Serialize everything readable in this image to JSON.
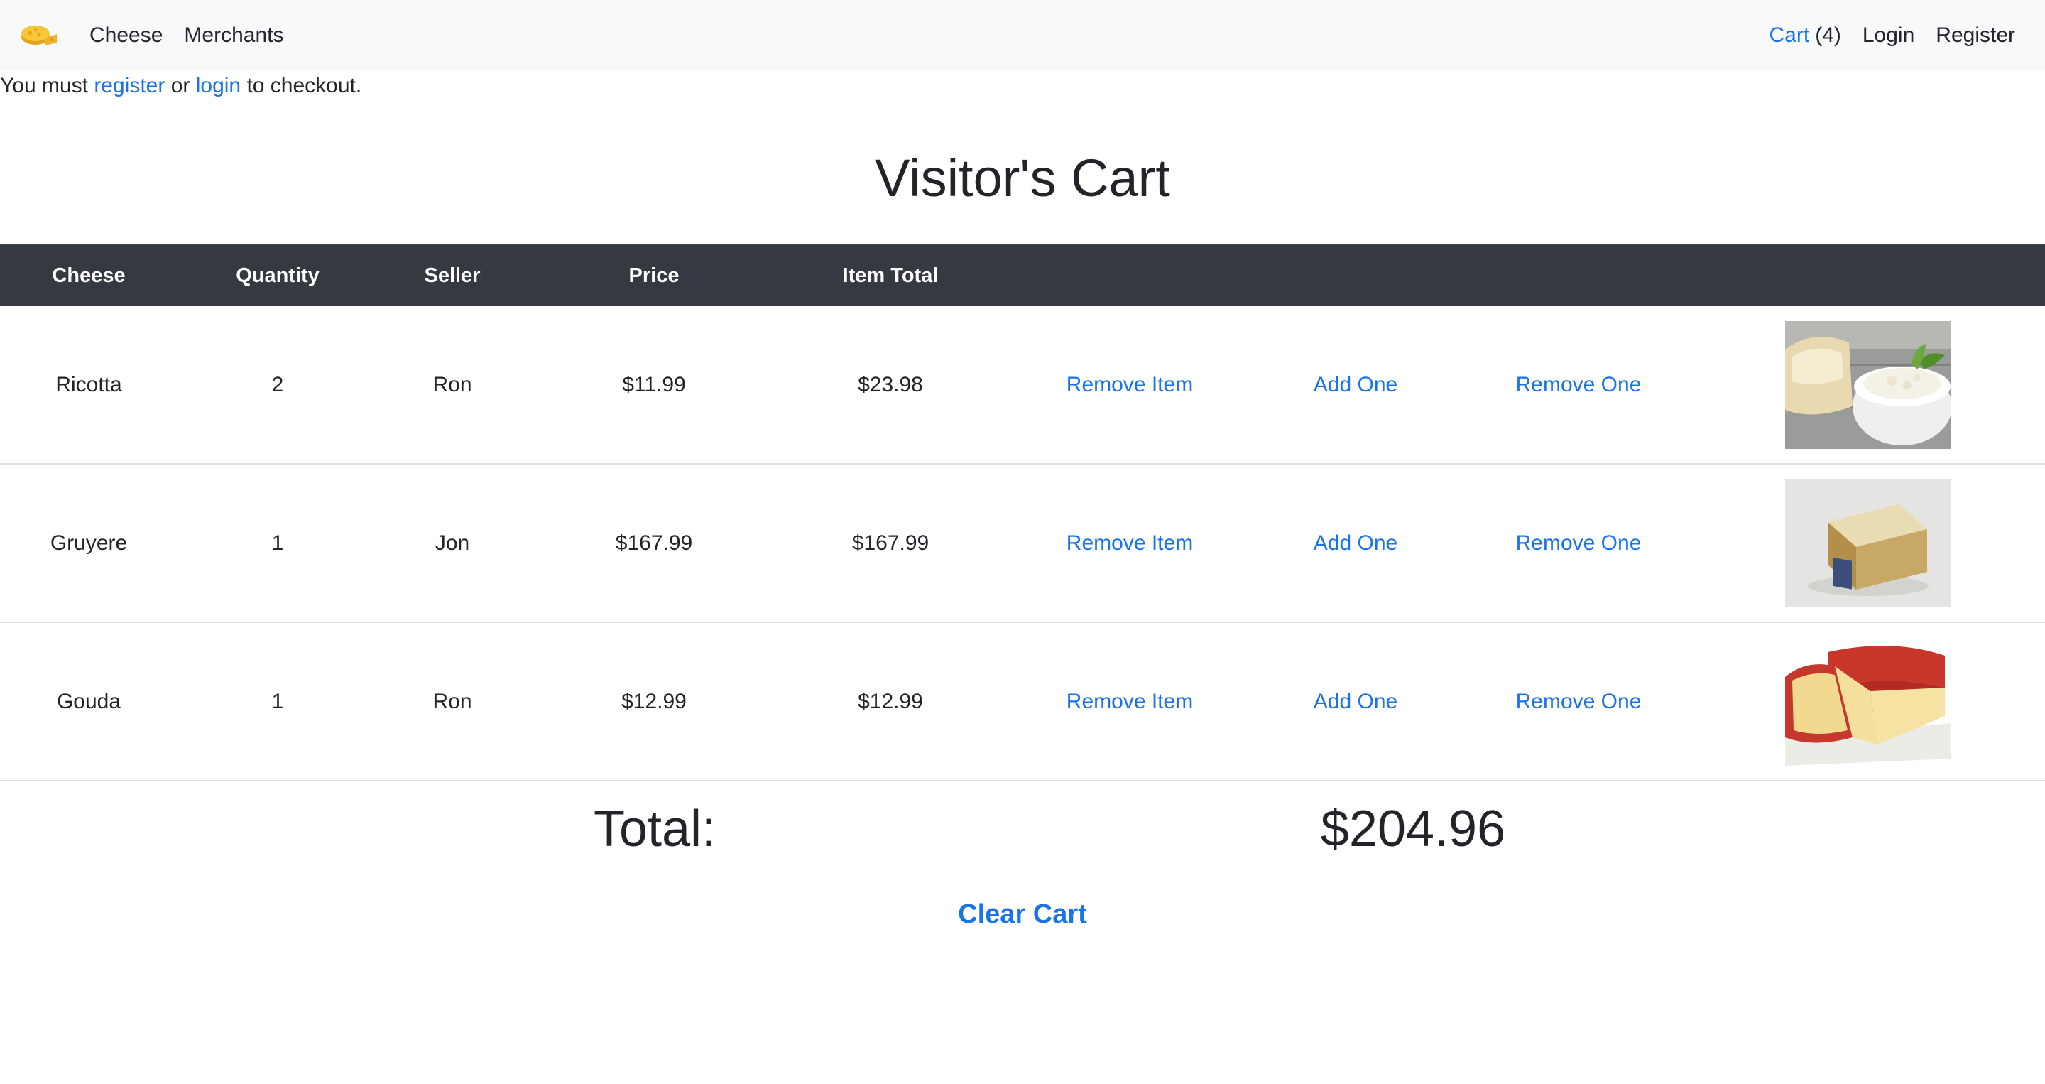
{
  "nav": {
    "brand_icon": "cheese-logo-icon",
    "left_links": [
      "Cheese",
      "Merchants"
    ],
    "cart_label": "Cart",
    "cart_count": "(4)",
    "login": "Login",
    "register": "Register"
  },
  "notice": {
    "prefix": "You must ",
    "register_link": "register",
    "middle": " or ",
    "login_link": "login",
    "suffix": " to checkout."
  },
  "page_title": "Visitor's Cart",
  "table": {
    "headers": [
      "Cheese",
      "Quantity",
      "Seller",
      "Price",
      "Item Total"
    ],
    "actions": {
      "remove_item": "Remove Item",
      "add_one": "Add One",
      "remove_one": "Remove One"
    },
    "rows": [
      {
        "cheese": "Ricotta",
        "quantity": "2",
        "seller": "Ron",
        "price": "$11.99",
        "item_total": "$23.98",
        "image": "ricotta-photo"
      },
      {
        "cheese": "Gruyere",
        "quantity": "1",
        "seller": "Jon",
        "price": "$167.99",
        "item_total": "$167.99",
        "image": "gruyere-photo"
      },
      {
        "cheese": "Gouda",
        "quantity": "1",
        "seller": "Ron",
        "price": "$12.99",
        "item_total": "$12.99",
        "image": "gouda-photo"
      }
    ]
  },
  "total": {
    "label": "Total:",
    "value": "$204.96"
  },
  "clear_cart": "Clear Cart",
  "colors": {
    "link": "#1a73e8",
    "navbar_bg": "#f8f9fa",
    "table_header_bg": "#343a40",
    "text": "#212529"
  }
}
